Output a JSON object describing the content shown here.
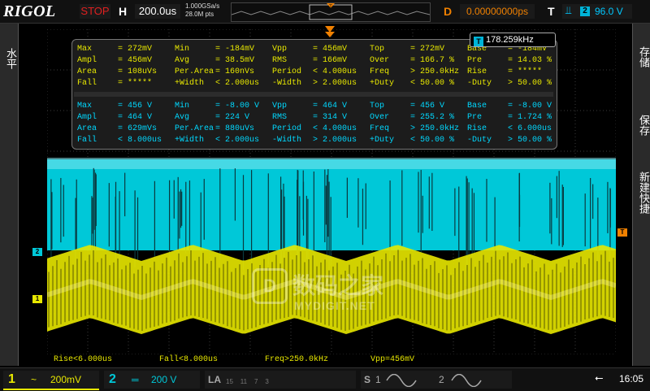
{
  "top": {
    "brand": "RIGOL",
    "run_state": "STOP",
    "h_label": "H",
    "h_value": "200.0us",
    "sample_rate": "1.000GSa/s",
    "mem_depth": "28.0M pts",
    "d_label": "D",
    "d_value": "0.00000000ps",
    "t_label": "T",
    "trigger_slope": "⫫",
    "trigger_source": "2",
    "trigger_level": "96.0 V"
  },
  "left_panel": {
    "tab": "水平"
  },
  "right_panel": {
    "tab_store": "存储",
    "tab_save": "保存",
    "tab_new": "新建快捷"
  },
  "freq_badge": {
    "source": "T",
    "value": "178.259kHz"
  },
  "measure": {
    "ch1": [
      [
        [
          "Max",
          "= 272mV"
        ],
        [
          "Min",
          "= -184mV"
        ],
        [
          "Vpp",
          "= 456mV"
        ],
        [
          "Top",
          "= 272mV"
        ],
        [
          "Base",
          "= -184mV"
        ]
      ],
      [
        [
          "Ampl",
          "= 456mV"
        ],
        [
          "Avg",
          "= 38.5mV"
        ],
        [
          "RMS",
          "= 166mV"
        ],
        [
          "Over",
          "= 166.7 %"
        ],
        [
          "Pre",
          "= 14.03 %"
        ]
      ],
      [
        [
          "Area",
          "= 108uVs"
        ],
        [
          "Per.Area",
          "= 160nVs"
        ],
        [
          "Period",
          "< 4.000us"
        ],
        [
          "Freq",
          "> 250.0kHz"
        ],
        [
          "Rise",
          "= *****"
        ]
      ],
      [
        [
          "Fall",
          "= *****"
        ],
        [
          "+Width",
          "< 2.000us"
        ],
        [
          "-Width",
          "> 2.000us"
        ],
        [
          "+Duty",
          "< 50.00 %"
        ],
        [
          "-Duty",
          "> 50.00 %"
        ]
      ]
    ],
    "ch2": [
      [
        [
          "Max",
          "= 456 V"
        ],
        [
          "Min",
          "= -8.00 V"
        ],
        [
          "Vpp",
          "= 464 V"
        ],
        [
          "Top",
          "= 456 V"
        ],
        [
          "Base",
          "= -8.00 V"
        ]
      ],
      [
        [
          "Ampl",
          "= 464 V"
        ],
        [
          "Avg",
          "= 224 V"
        ],
        [
          "RMS",
          "= 314 V"
        ],
        [
          "Over",
          "= 255.2 %"
        ],
        [
          "Pre",
          "= 1.724 %"
        ]
      ],
      [
        [
          "Area",
          "= 629mVs"
        ],
        [
          "Per.Area",
          "= 880uVs"
        ],
        [
          "Period",
          "< 4.000us"
        ],
        [
          "Freq",
          "> 250.0kHz"
        ],
        [
          "Rise",
          "< 6.000us"
        ]
      ],
      [
        [
          "Fall",
          "< 8.000us"
        ],
        [
          "+Width",
          "< 2.000us"
        ],
        [
          "-Width",
          "> 2.000us"
        ],
        [
          "+Duty",
          "< 50.00 %"
        ],
        [
          "-Duty",
          "> 50.00 %"
        ]
      ]
    ]
  },
  "markers": {
    "ch2": "2",
    "ch1": "1",
    "trigger": "T"
  },
  "watermark": {
    "logo": "D",
    "cn": "数码之家",
    "en": "MYDIGIT.NET"
  },
  "measure_strip": [
    "Rise<6.000us",
    "Fall<8.000us",
    "Freq>250.0kHz",
    "Vpp=456mV"
  ],
  "bottom": {
    "ch1_num": "1",
    "ch1_coupling": "~",
    "ch1_scale": "200mV",
    "ch2_num": "2",
    "ch2_coupling": "═",
    "ch2_scale": "200 V",
    "la_label": "LA",
    "la_ticks": "15    11    7    3",
    "s1_label": "S",
    "s1_num": "1",
    "s2_num": "2",
    "usb_icon": "⭠",
    "time": "16:05"
  },
  "colors": {
    "ch1": "#e8e800",
    "ch2": "#00c8d8",
    "trigger": "#f08000"
  }
}
